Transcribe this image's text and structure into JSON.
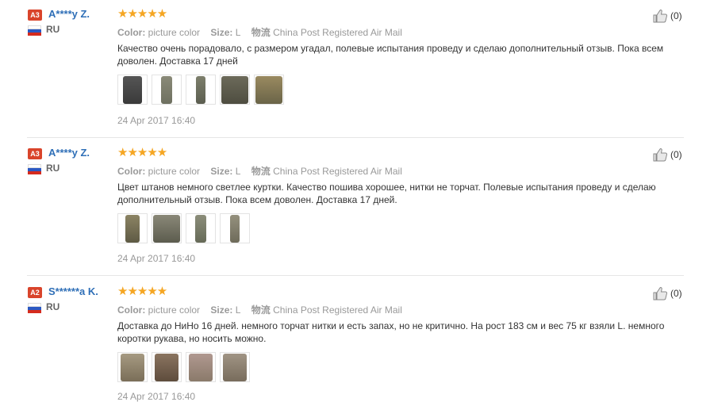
{
  "colors": {
    "accent": "#f5a623",
    "name": "#2f6fb7",
    "badge": "#d9442b"
  },
  "labels": {
    "color": "Color:",
    "size": "Size:",
    "shipping_icon_text": "物流"
  },
  "reviews": [
    {
      "badge": "A3",
      "name": "A****y Z.",
      "country": "RU",
      "stars": "★★★★★",
      "rating": 5,
      "color_value": "picture color",
      "size_value": "L",
      "shipping": "China Post Registered Air Mail",
      "text": "Качество очень порадовало, с размером угадал, полевые испытания проведу и сделаю дополнительный отзыв. Пока всем доволен. Доставка 17 дней",
      "photo_count": 5,
      "date": "24 Apr 2017 16:40",
      "likes": "(0)"
    },
    {
      "badge": "A3",
      "name": "A****y Z.",
      "country": "RU",
      "stars": "★★★★★",
      "rating": 5,
      "color_value": "picture color",
      "size_value": "L",
      "shipping": "China Post Registered Air Mail",
      "text": "Цвет штанов немного светлее куртки. Качество пошива хорошее, нитки не торчат. Полевые испытания проведу и сделаю дополнительный отзыв. Пока всем доволен. Доставка 17 дней.",
      "photo_count": 4,
      "date": "24 Apr 2017 16:40",
      "likes": "(0)"
    },
    {
      "badge": "A2",
      "name": "S******a K.",
      "country": "RU",
      "stars": "★★★★★",
      "rating": 5,
      "color_value": "picture color",
      "size_value": "L",
      "shipping": "China Post Registered Air Mail",
      "text": "Доставка до НиНо 16 дней. немного торчат нитки и есть запах, но не критично. На рост 183 см и вес 75 кг взяли L. немного коротки рукава, но носить можно.",
      "photo_count": 4,
      "date": "24 Apr 2017 16:40",
      "likes": "(0)"
    }
  ]
}
